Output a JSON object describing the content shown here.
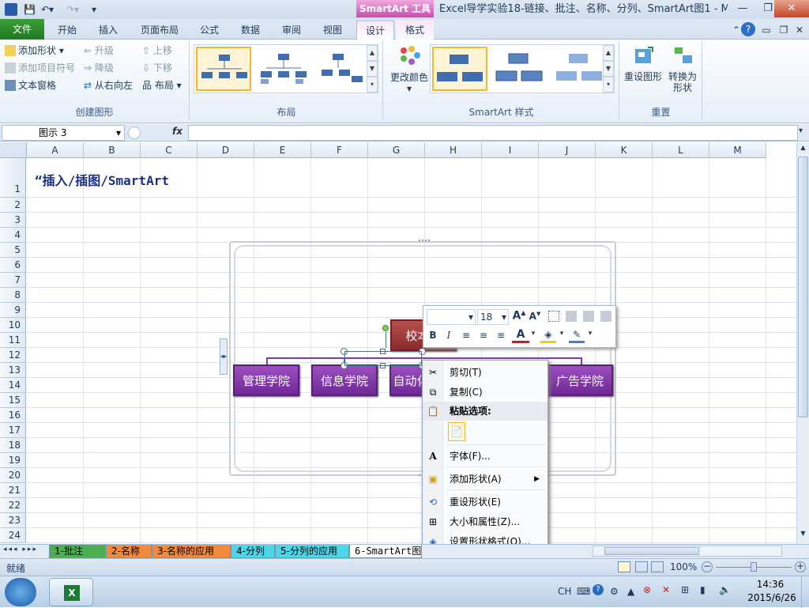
{
  "qat": {
    "save_icon": "save-icon",
    "undo_icon": "undo-icon",
    "redo_icon": "redo-icon",
    "customize_icon": "chevron-down-icon"
  },
  "context_tab": "SmartArt 工具",
  "window_title": "Excel导学实验18-链接、批注、名称、分列、SmartArt图1 - M...",
  "tabs": {
    "file": "文件",
    "home": "开始",
    "insert": "插入",
    "page_layout": "页面布局",
    "formulas": "公式",
    "data": "数据",
    "review": "审阅",
    "view": "视图",
    "design": "设计",
    "format": "格式"
  },
  "ribbon": {
    "create_graphic": {
      "label": "创建图形",
      "add_shape": "添加形状",
      "add_bullet": "添加项目符号",
      "text_pane": "文本窗格",
      "promote": "升级",
      "demote": "降级",
      "right_to_left": "从右向左",
      "move_up": "上移",
      "move_down": "下移",
      "layout": "布局"
    },
    "layouts": {
      "label": "布局"
    },
    "styles": {
      "label": "SmartArt 样式",
      "change_colors": "更改颜色"
    },
    "reset": {
      "label": "重置",
      "reset_graphic": "重设图形",
      "convert_line1": "转换为",
      "convert_line2": "形状"
    }
  },
  "formula_bar": {
    "name_box": "图示 3",
    "fx": "fx",
    "value": ""
  },
  "columns": [
    "A",
    "B",
    "C",
    "D",
    "E",
    "F",
    "G",
    "H",
    "I",
    "J",
    "K",
    "L",
    "M"
  ],
  "rows": [
    "1",
    "2",
    "3",
    "4",
    "5",
    "6",
    "7",
    "8",
    "9",
    "10",
    "11",
    "12",
    "13",
    "14",
    "15",
    "16",
    "17",
    "18",
    "19",
    "20",
    "21",
    "22",
    "23",
    "24"
  ],
  "cells": {
    "A1": "“插入/插图/SmartArt"
  },
  "smartart": {
    "root": "校本部",
    "children": [
      "管理学院",
      "信息学院",
      "自动化学院",
      "",
      "广告学院"
    ]
  },
  "mini_toolbar": {
    "font": "",
    "size": "18",
    "grow": "A",
    "shrink": "A",
    "bold": "B",
    "italic": "I",
    "font_color": "A"
  },
  "context_menu": {
    "cut": "剪切(T)",
    "copy": "复制(C)",
    "paste_options": "粘贴选项:",
    "font": "字体(F)...",
    "add_shape": "添加形状(A)",
    "reset_shape": "重设形状(E)",
    "size_props": "大小和属性(Z)...",
    "format_shape": "设置形状格式(O)..."
  },
  "sheet_tabs": [
    {
      "label": "1-批注",
      "color": "#4caf50"
    },
    {
      "label": "2-名称",
      "color": "#f08a3c"
    },
    {
      "label": "3-名称的应用",
      "color": "#f08a3c"
    },
    {
      "label": "4-分列",
      "color": "#4dd6e6"
    },
    {
      "label": "5-分列的应用",
      "color": "#4dd6e6"
    },
    {
      "label": "6-SmartArt图",
      "color": "#ffffff"
    }
  ],
  "status": {
    "ready": "就绪",
    "zoom": "100%"
  },
  "taskbar": {
    "lang": "CH",
    "time": "14:36",
    "date": "2015/6/26"
  }
}
